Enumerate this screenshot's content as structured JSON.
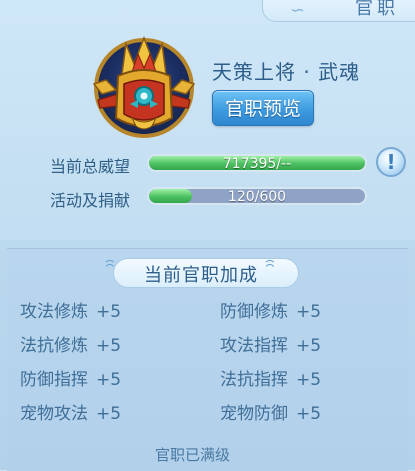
{
  "header": {
    "title": "官职"
  },
  "rank": {
    "name": "天策上将 · 武魂",
    "preview_button": "官职预览"
  },
  "stats": [
    {
      "label": "当前总威望",
      "value_text": "717395/--",
      "fill_fraction": 1.0
    },
    {
      "label": "活动及捐献",
      "value_text": "120/600",
      "fill_fraction": 0.2
    }
  ],
  "info_icon": {
    "glyph": "!",
    "icon": "exclamation-icon"
  },
  "bonus": {
    "title": "当前官职加成",
    "items": [
      {
        "name": "攻法修炼",
        "value": "+5"
      },
      {
        "name": "防御修炼",
        "value": "+5"
      },
      {
        "name": "法抗修炼",
        "value": "+5"
      },
      {
        "name": "攻法指挥",
        "value": "+5"
      },
      {
        "name": "防御指挥",
        "value": "+5"
      },
      {
        "name": "法抗指挥",
        "value": "+5"
      },
      {
        "name": "宠物攻法",
        "value": "+5"
      },
      {
        "name": "宠物防御",
        "value": "+5"
      }
    ],
    "footer": "官职已满级"
  },
  "colors": {
    "accent": "#3d9be0",
    "bar_fill": "#4cc061",
    "text": "#2f5f86"
  }
}
